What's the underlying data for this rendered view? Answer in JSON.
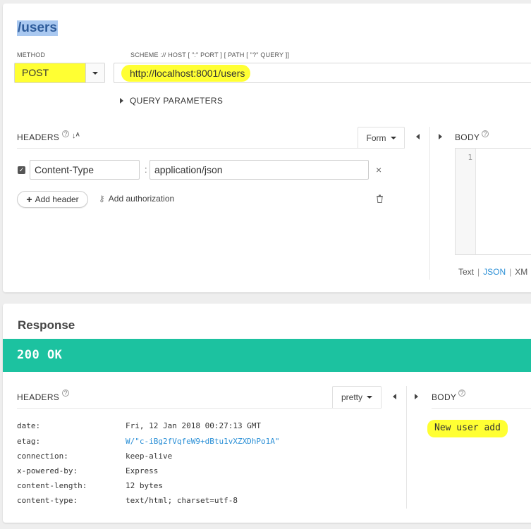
{
  "request": {
    "title": "/users",
    "method_label": "METHOD",
    "method": "POST",
    "url_label": "SCHEME :// HOST [ \":\" PORT ] [ PATH [ \"?\" QUERY ]]",
    "url": "http://localhost:8001/users",
    "query_params_label": "QUERY PARAMETERS",
    "headers_label": "HEADERS",
    "form_label": "Form",
    "body_label": "BODY",
    "header_rows": [
      {
        "name": "Content-Type",
        "value": "application/json",
        "separator": ":"
      }
    ],
    "add_header_label": "Add header",
    "add_authorization_label": "Add authorization",
    "body_editor": {
      "line_number": "1"
    },
    "body_modes": [
      "Text",
      "JSON",
      "XM"
    ],
    "body_mode_separator": "|",
    "active_body_mode": "JSON"
  },
  "response": {
    "title": "Response",
    "status": "200 OK",
    "headers_label": "HEADERS",
    "format_label": "pretty",
    "body_label": "BODY",
    "headers": [
      {
        "key": "date:",
        "value": "Fri, 12 Jan 2018 00:27:13 GMT"
      },
      {
        "key": "etag:",
        "value": "W/\"c-iBg2fVqfeW9+dBtu1vXZXDhPo1A\""
      },
      {
        "key": "connection:",
        "value": "keep-alive"
      },
      {
        "key": "x-powered-by:",
        "value": "Express"
      },
      {
        "key": "content-length:",
        "value": "12 bytes"
      },
      {
        "key": "content-type:",
        "value": "text/html; charset=utf-8"
      }
    ],
    "body": "New user add"
  },
  "colors": {
    "status_bar": "#1cc2a0",
    "link": "#2a8fd6",
    "highlight": "#ffff33"
  },
  "icons": {
    "help": "question-circle-icon",
    "sort": "sort-alpha-icon",
    "delete": "trash-icon",
    "remove": "close-icon",
    "plus": "plus-icon",
    "key": "key-icon"
  }
}
